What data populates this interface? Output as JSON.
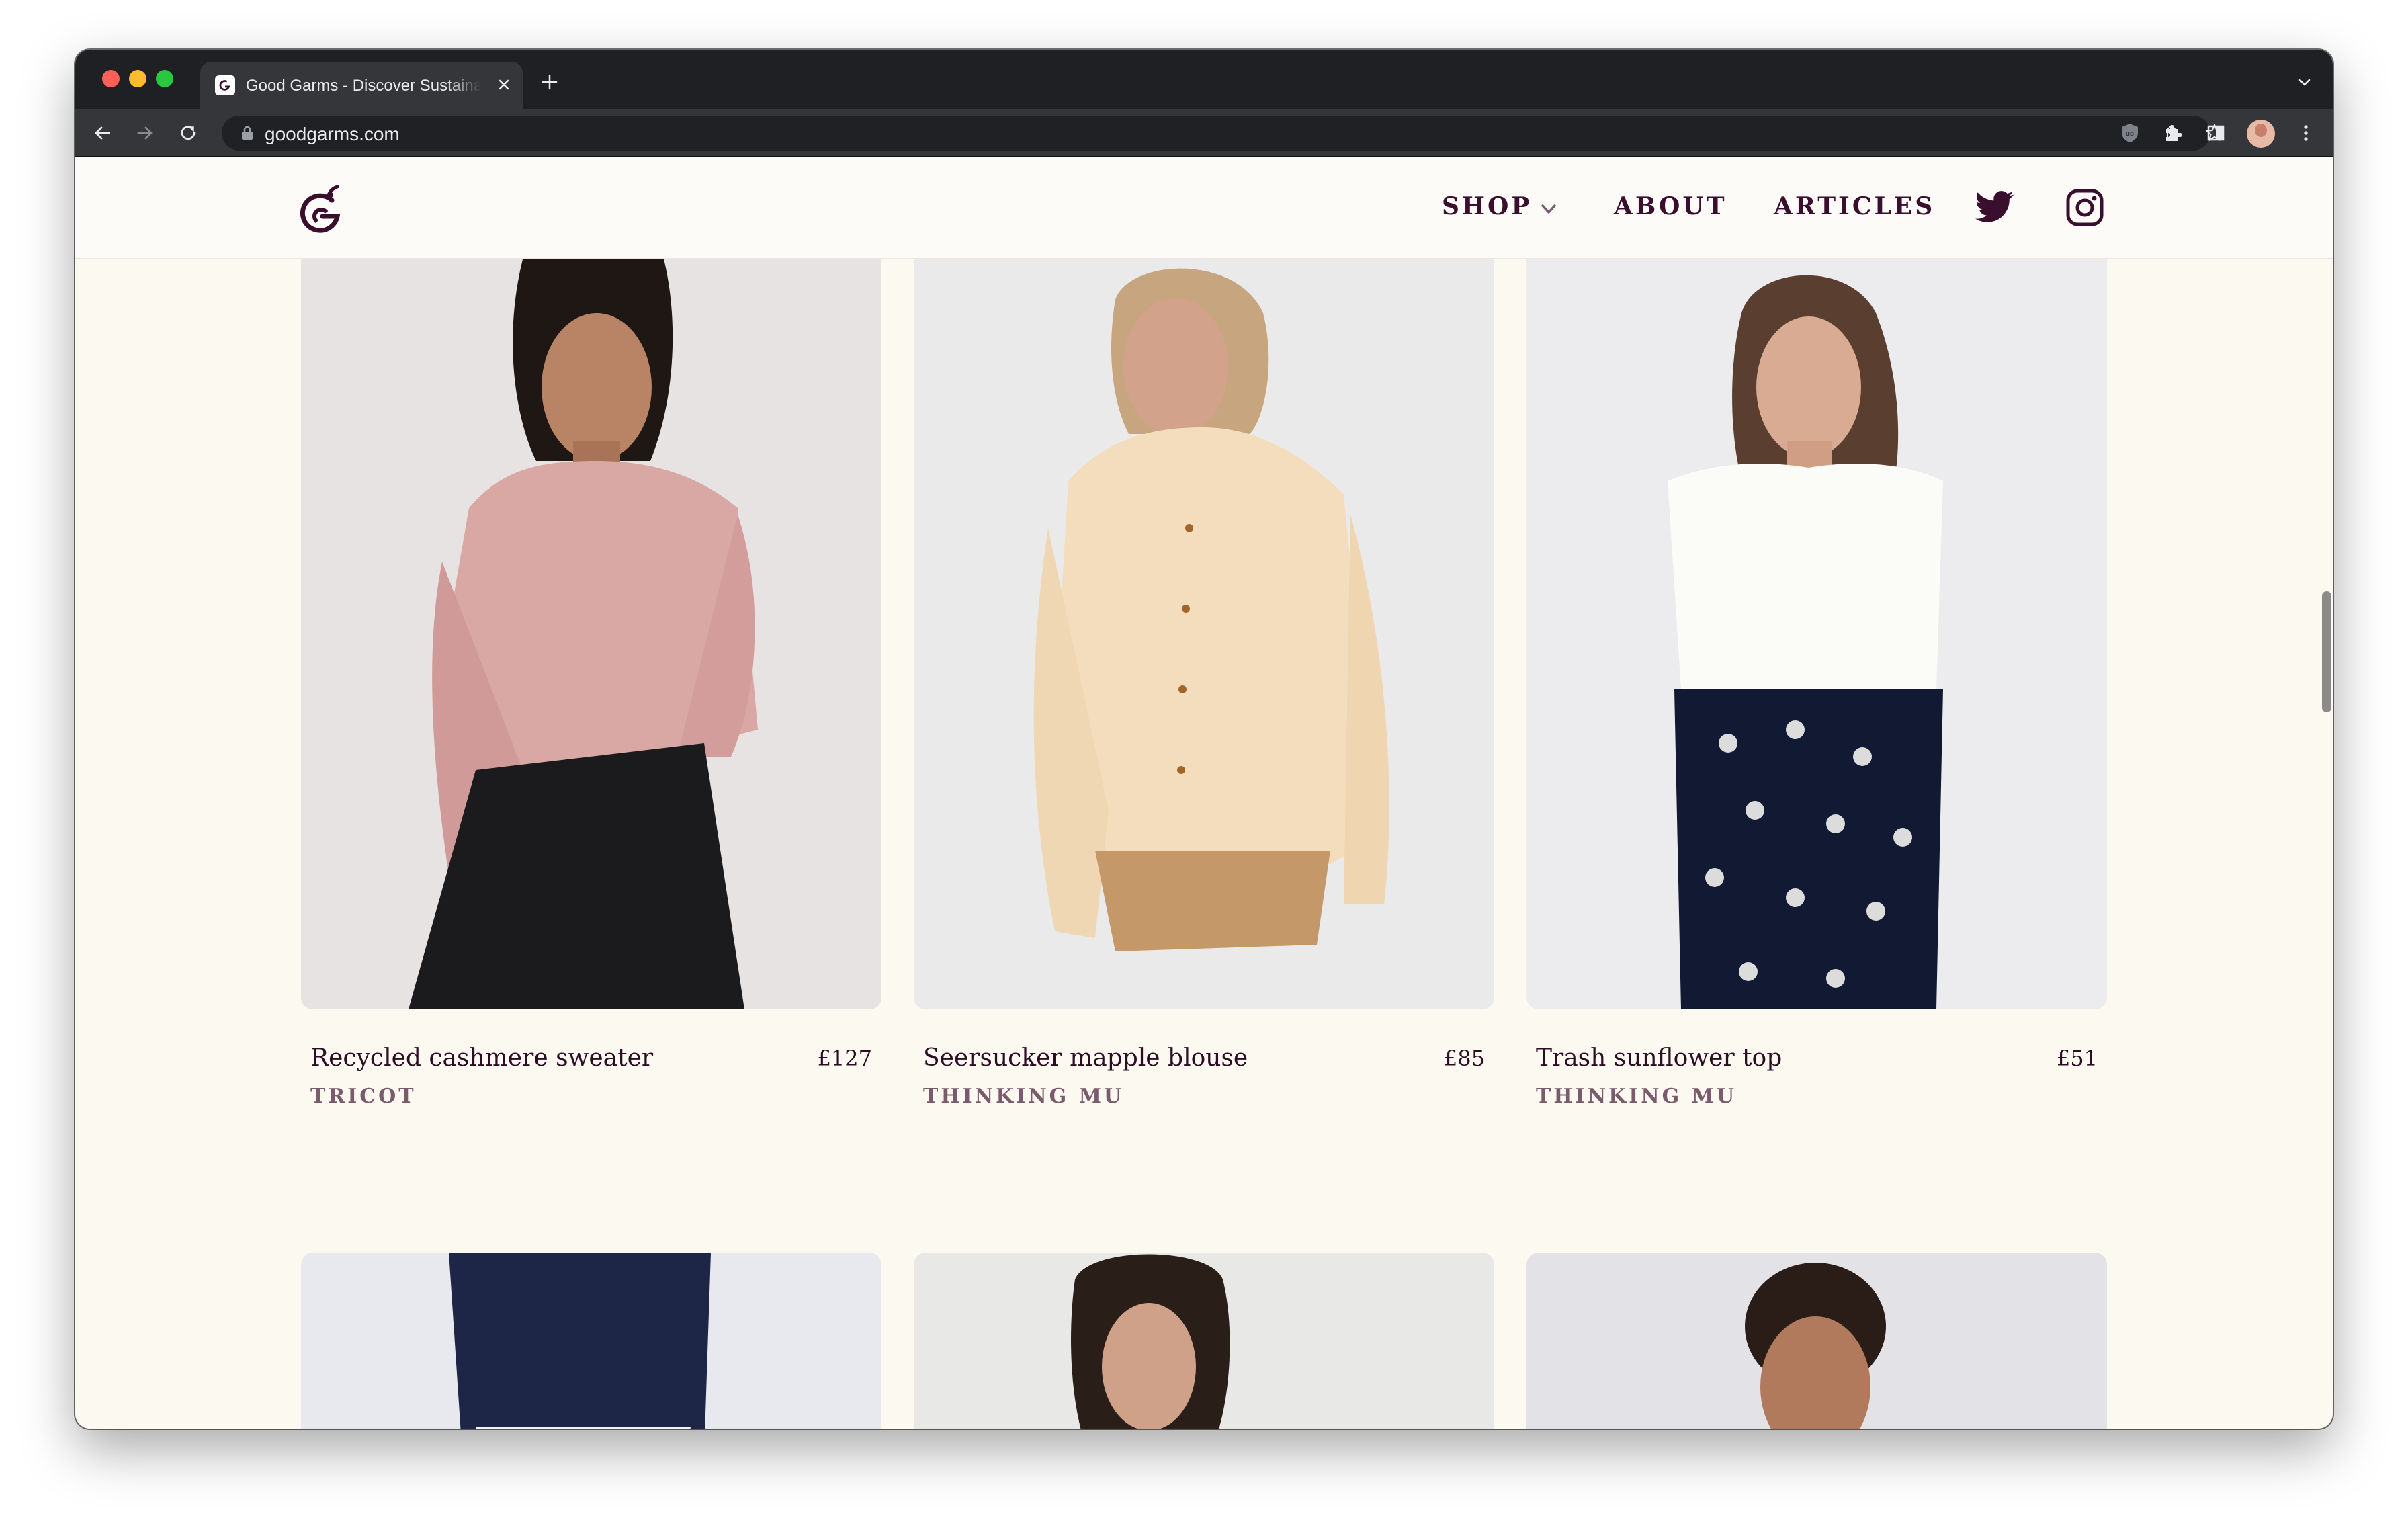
{
  "browser": {
    "tab_title": "Good Garms - Discover Sustainable Fashion",
    "url": "goodgarms.com"
  },
  "nav": {
    "shop": "SHOP",
    "about": "ABOUT",
    "articles": "ARTICLES"
  },
  "products": [
    {
      "name": "Recycled cashmere sweater",
      "price": "£127",
      "brand": "TRICOT"
    },
    {
      "name": "Seersucker mapple blouse",
      "price": "£85",
      "brand": "THINKING MU"
    },
    {
      "name": "Trash sunflower top",
      "price": "£51",
      "brand": "THINKING MU"
    }
  ],
  "colors": {
    "brand": "#3a0f2e",
    "brand_muted": "#7a5a6d",
    "page_bg": "#fcf9f1",
    "chrome_dark": "#1f2023"
  },
  "icons": {
    "logo": "good-garms-logo-icon",
    "twitter": "twitter-icon",
    "instagram": "instagram-icon"
  }
}
